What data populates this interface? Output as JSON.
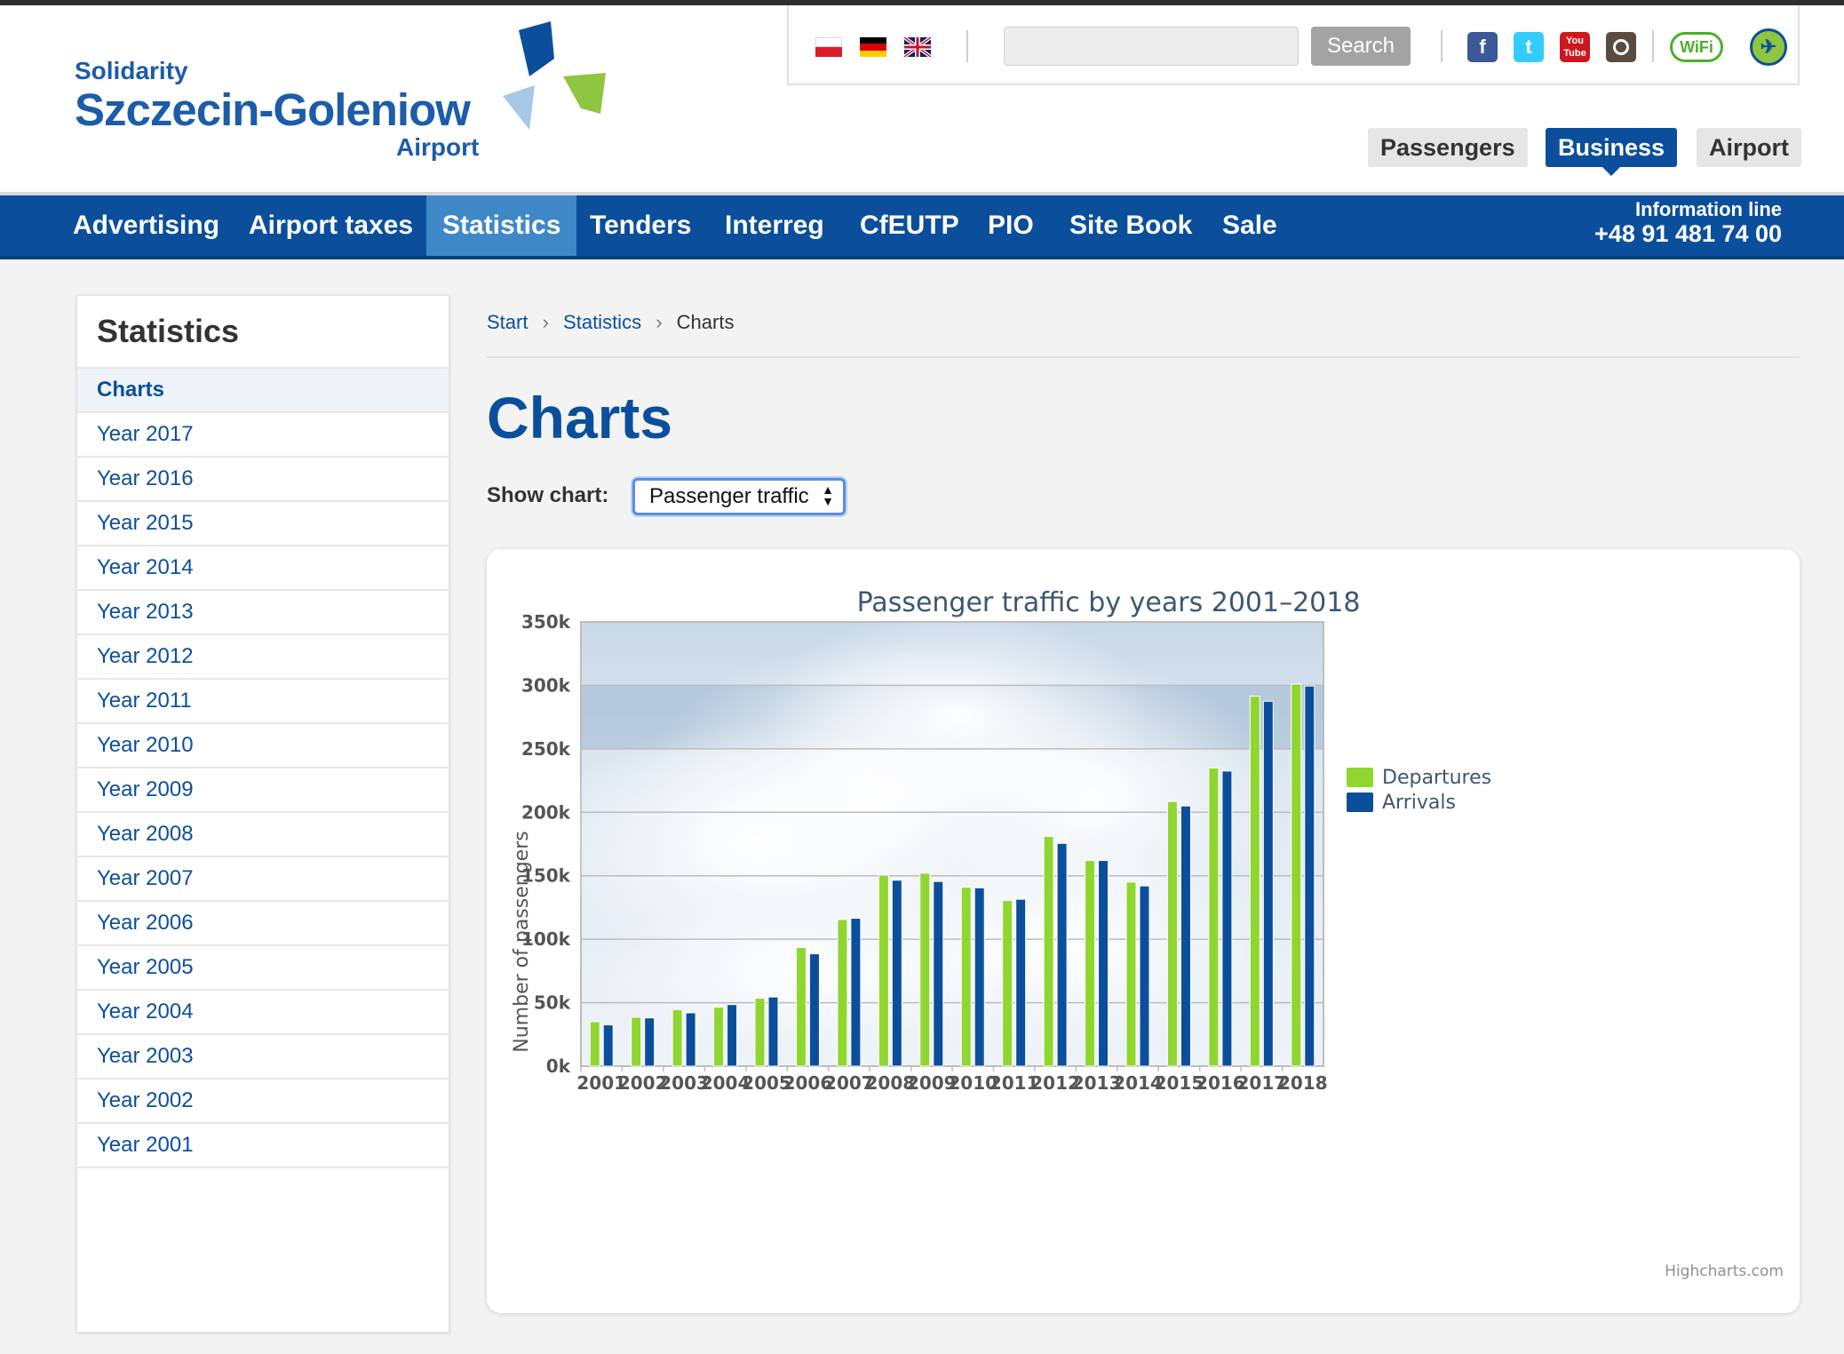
{
  "header": {
    "logo": {
      "line1": "Solidarity",
      "line2": "Szczecin-Goleniow",
      "line3": "Airport"
    },
    "languages": [
      "pl-flag",
      "de-flag",
      "en-flag"
    ],
    "search": {
      "placeholder": "",
      "button_label": "Search"
    },
    "social": [
      "facebook-icon",
      "twitter-icon",
      "youtube-icon",
      "instagram-icon",
      "wifi-icon",
      "plane-icon"
    ],
    "section_tabs": [
      {
        "label": "Passengers",
        "active": false
      },
      {
        "label": "Business",
        "active": true
      },
      {
        "label": "Airport",
        "active": false
      }
    ]
  },
  "nav": {
    "items": [
      {
        "label": "Advertising",
        "active": false
      },
      {
        "label": "Airport taxes",
        "active": false
      },
      {
        "label": "Statistics",
        "active": true
      },
      {
        "label": "Tenders",
        "active": false
      },
      {
        "label": "Interreg",
        "active": false
      },
      {
        "label": "CfEUTP",
        "active": false
      },
      {
        "label": "PIO",
        "active": false
      },
      {
        "label": "Site Book",
        "active": false
      },
      {
        "label": "Sale",
        "active": false
      }
    ],
    "info_line_label": "Information line",
    "info_line_number": "+48 91 481 74 00"
  },
  "sidebar": {
    "title": "Statistics",
    "items": [
      {
        "label": "Charts",
        "active": true
      },
      {
        "label": "Year 2017"
      },
      {
        "label": "Year 2016"
      },
      {
        "label": "Year 2015"
      },
      {
        "label": "Year 2014"
      },
      {
        "label": "Year 2013"
      },
      {
        "label": "Year 2012"
      },
      {
        "label": "Year 2011"
      },
      {
        "label": "Year 2010"
      },
      {
        "label": "Year 2009"
      },
      {
        "label": "Year 2008"
      },
      {
        "label": "Year 2007"
      },
      {
        "label": "Year 2006"
      },
      {
        "label": "Year 2005"
      },
      {
        "label": "Year 2004"
      },
      {
        "label": "Year 2003"
      },
      {
        "label": "Year 2002"
      },
      {
        "label": "Year 2001"
      }
    ]
  },
  "breadcrumb": {
    "start": "Start",
    "statistics": "Statistics",
    "current": "Charts"
  },
  "content": {
    "title": "Charts",
    "show_chart_label": "Show chart:",
    "show_chart_value": "Passenger traffic",
    "credit": "Highcharts.com"
  },
  "colors": {
    "brand_blue": "#0b4f9c",
    "departures": "#8fd630",
    "arrivals": "#0b4f9c"
  },
  "chart_data": {
    "type": "bar",
    "title": "Passenger traffic by years 2001–2018",
    "xlabel": "",
    "ylabel": "Number of passengers",
    "ylim": [
      0,
      350000
    ],
    "yticks": [
      "0k",
      "50k",
      "100k",
      "150k",
      "200k",
      "250k",
      "300k",
      "350k"
    ],
    "legend_position": "right",
    "categories": [
      "2001",
      "2002",
      "2003",
      "2004",
      "2005",
      "2006",
      "2007",
      "2008",
      "2009",
      "2010",
      "2011",
      "2012",
      "2013",
      "2014",
      "2015",
      "2016",
      "2017",
      "2018"
    ],
    "series": [
      {
        "name": "Departures",
        "values": [
          35000,
          38500,
          44500,
          46500,
          53500,
          93500,
          115500,
          150500,
          152000,
          141000,
          130500,
          181000,
          162000,
          145000,
          208500,
          235000,
          291500,
          301000
        ]
      },
      {
        "name": "Arrivals",
        "values": [
          32500,
          38000,
          42000,
          48500,
          54500,
          88500,
          116500,
          146500,
          145500,
          140500,
          131500,
          175500,
          162000,
          142000,
          205000,
          232500,
          287500,
          299500
        ]
      }
    ]
  }
}
